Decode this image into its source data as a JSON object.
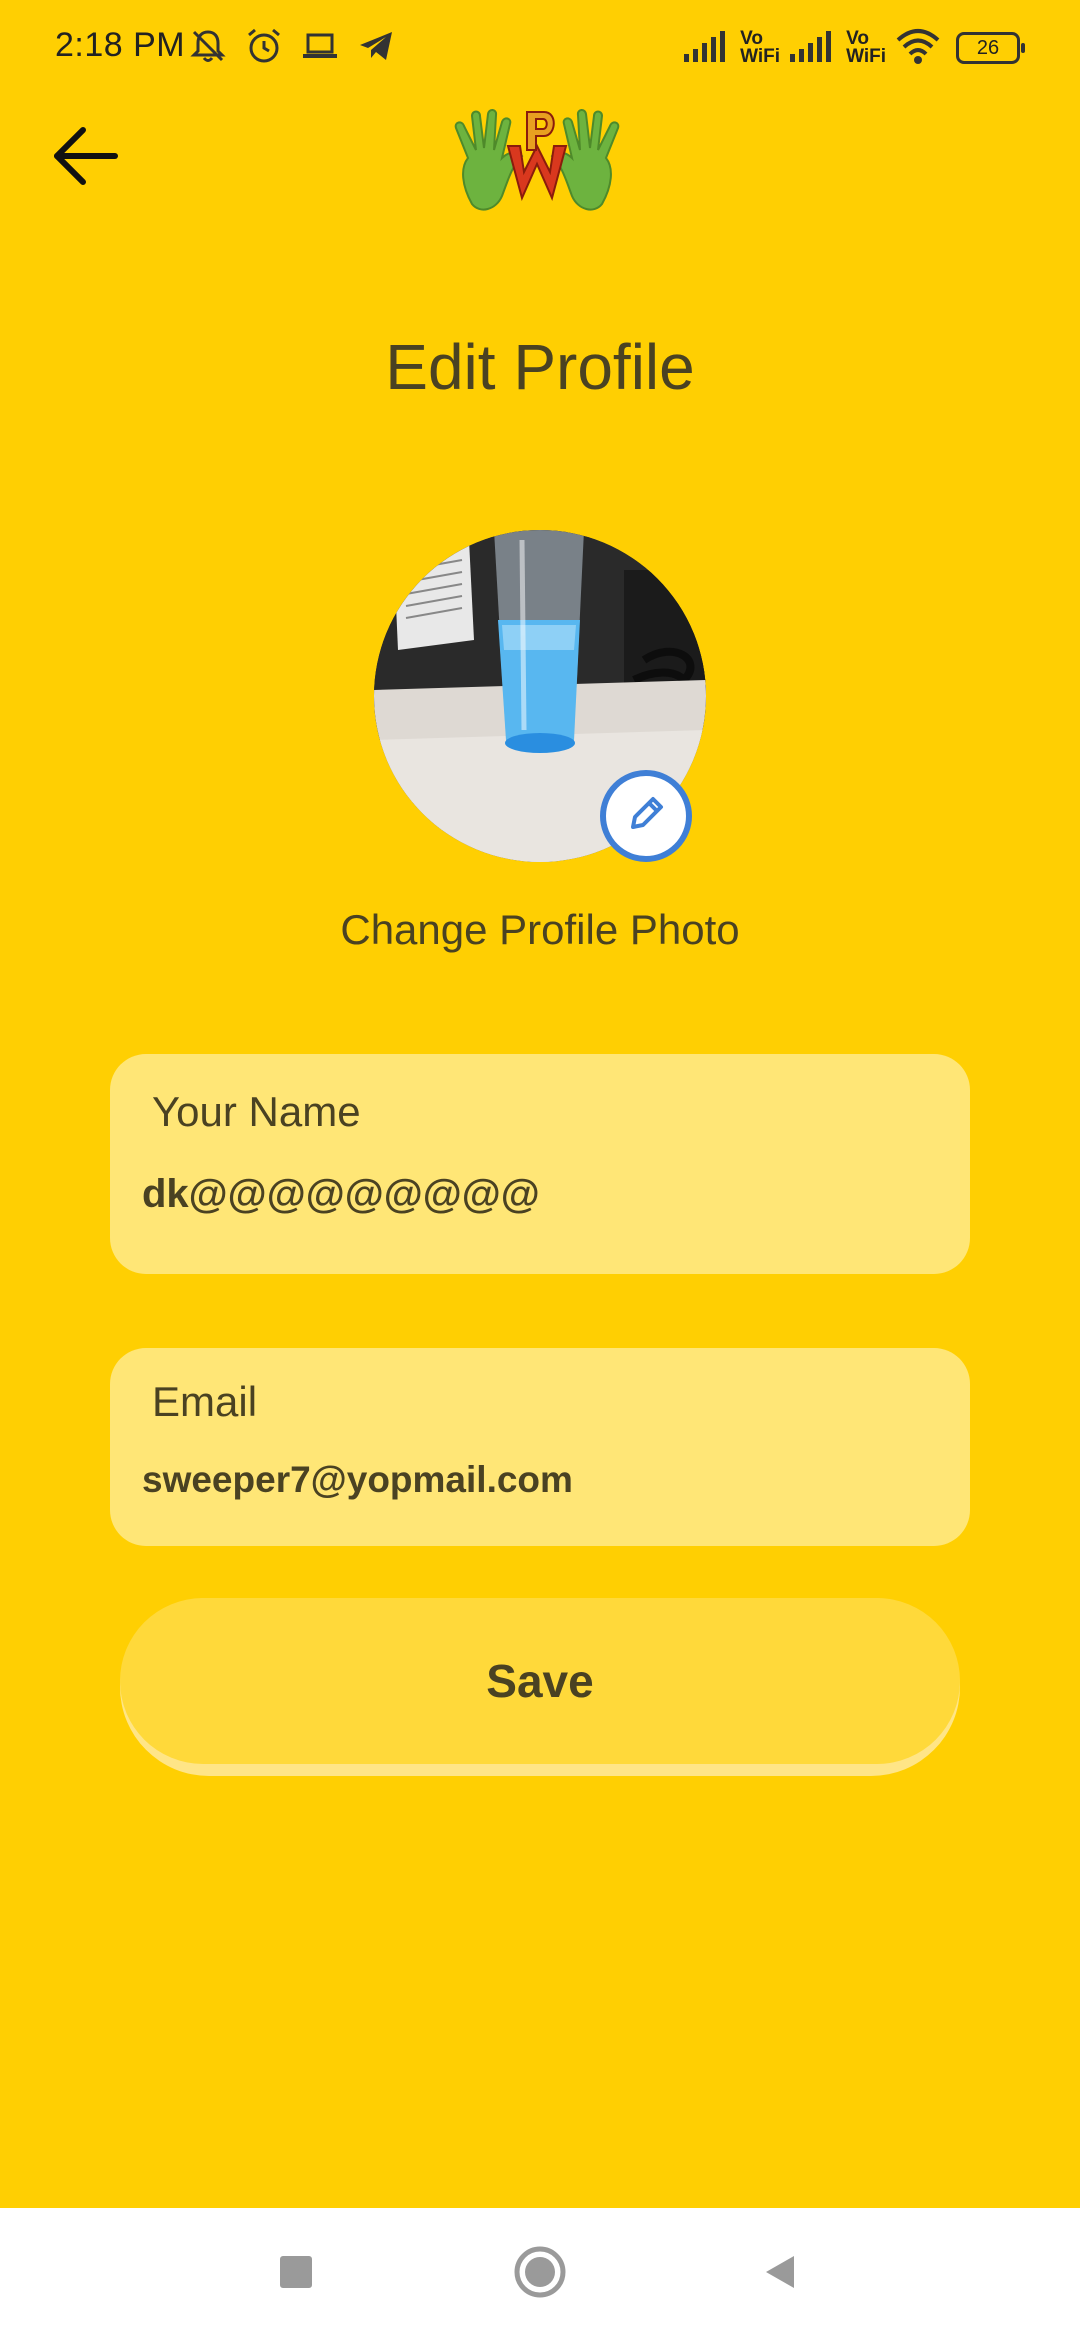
{
  "status_bar": {
    "time": "2:18 PM",
    "left_icons": [
      "muted-notifications-icon",
      "alarm-icon",
      "laptop-icon",
      "telegram-icon"
    ],
    "vowifi_label_1": "Vo\nWiFi",
    "vowifi_label_2": "Vo\nWiFi",
    "battery_level": "26"
  },
  "header": {
    "back_icon": "arrow-back-icon",
    "logo": "app-logo-hands"
  },
  "page": {
    "title": "Edit Profile",
    "change_photo_label": "Change Profile Photo"
  },
  "form": {
    "name_label": "Your Name",
    "name_value": "dk@@@@@@@@@",
    "email_label": "Email",
    "email_value": "sweeper7@yopmail.com",
    "save_label": "Save"
  },
  "nav_bar": {
    "items": [
      "recents-square-icon",
      "home-circle-icon",
      "back-triangle-icon"
    ]
  },
  "colors": {
    "background": "#ffcf02",
    "field_bg": "#ffe676",
    "button_bg": "#ffd93a",
    "text": "#4a4222",
    "edit_accent": "#3f7fd6"
  }
}
